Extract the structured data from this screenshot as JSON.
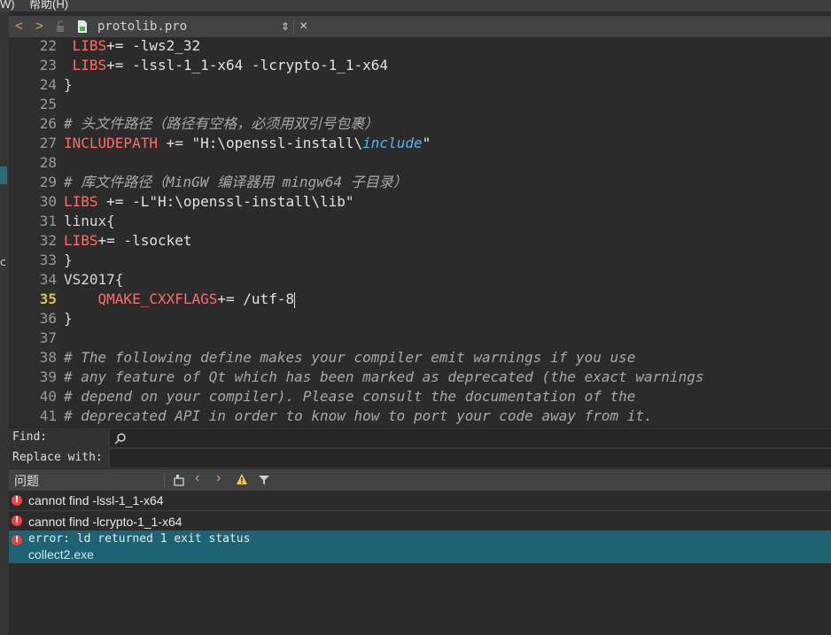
{
  "menubar": {
    "window_menu": "W)",
    "help_menu": "帮助(H)"
  },
  "tab": {
    "filename": "protolib.pro",
    "back": "<",
    "forward": ">",
    "close": "×",
    "dropdown": "⇕"
  },
  "left_char": "c",
  "editor": {
    "current_line": 35,
    "lines": [
      {
        "n": "22",
        "indent": " ",
        "kw": "LIBS",
        "rest": "+= -lws2_32"
      },
      {
        "n": "23",
        "indent": " ",
        "kw": "LIBS",
        "rest": "+= -lssl-1_1-x64 -lcrypto-1_1-x64"
      },
      {
        "n": "24",
        "text": "}"
      },
      {
        "n": "25",
        "text": ""
      },
      {
        "n": "26",
        "comment": "# 头文件路径（路径有空格，必须用双引号包裹）"
      },
      {
        "n": "27",
        "kw": "INCLUDEPATH",
        "rest": " += \"H:\\openssl-install\\",
        "inc": "include",
        "tail": "\""
      },
      {
        "n": "28",
        "text": ""
      },
      {
        "n": "29",
        "comment": "# 库文件路径（MinGW 编译器用 mingw64 子目录）"
      },
      {
        "n": "30",
        "kw": "LIBS",
        "rest": " += -L\"H:\\openssl-install\\lib\""
      },
      {
        "n": "31",
        "text": "linux{"
      },
      {
        "n": "32",
        "kw": "LIBS",
        "rest": "+= -lsocket"
      },
      {
        "n": "33",
        "text": "}"
      },
      {
        "n": "34",
        "text": "VS2017{"
      },
      {
        "n": "35",
        "indent": "    ",
        "kw": "QMAKE_CXXFLAGS",
        "rest": "+= /utf-8",
        "cursor": true
      },
      {
        "n": "36",
        "text": "}"
      },
      {
        "n": "37",
        "text": ""
      },
      {
        "n": "38",
        "comment": "# The following define makes your compiler emit warnings if you use"
      },
      {
        "n": "39",
        "comment": "# any feature of Qt which has been marked as deprecated (the exact warnings"
      },
      {
        "n": "40",
        "comment": "# depend on your compiler). Please consult the documentation of the"
      },
      {
        "n": "41",
        "comment": "# deprecated API in order to know how to port your code away from it."
      }
    ]
  },
  "find": {
    "find_label": "Find:",
    "replace_label": "Replace with:",
    "find_value": "",
    "replace_value": ""
  },
  "issues": {
    "title": "问题",
    "items": [
      {
        "icon": "!",
        "text": "cannot find -lssl-1_1-x64"
      },
      {
        "icon": "!",
        "text": "cannot find -lcrypto-1_1-x64"
      },
      {
        "icon": "!",
        "text": "error: ld returned 1 exit status",
        "sub": "collect2.exe"
      }
    ]
  }
}
